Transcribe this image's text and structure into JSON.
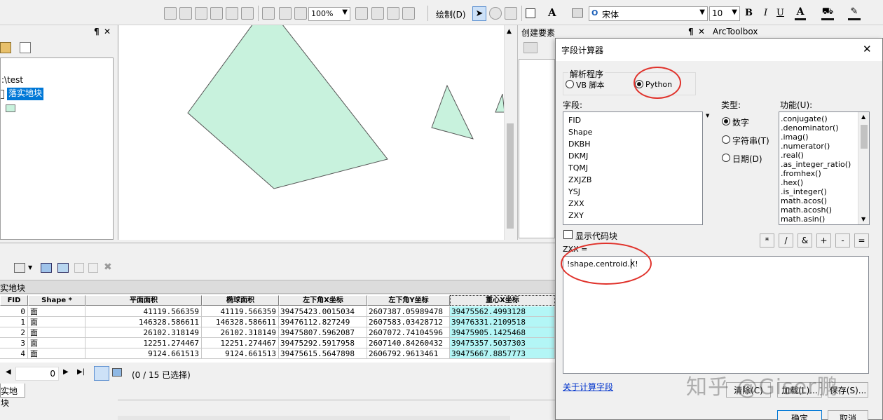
{
  "toolbar": {
    "zoom_value": "100%",
    "draw_label": "绘制(D)",
    "text_tool": "A",
    "font_name": "宋体",
    "font_size": "10",
    "bold": "B",
    "italic": "I",
    "underline": "U"
  },
  "toc": {
    "path": ":\\test",
    "layer": "落实地块"
  },
  "panels": {
    "create_features": "创建要素",
    "arctoolbox": "ArcToolbox",
    "pin": "¶",
    "close": "✕"
  },
  "table": {
    "title": "实地块",
    "columns": [
      "FID",
      "Shape *",
      "平面面积",
      "椭球面积",
      "左下角X坐标",
      "左下角Y坐标",
      "重心X坐标"
    ],
    "rows": [
      [
        "0",
        "面",
        "41119.566359",
        "41119.566359",
        "39475423.0015034",
        "2607387.05989478",
        "39475562.4993128"
      ],
      [
        "1",
        "面",
        "146328.586611",
        "146328.586611",
        "39476112.827249",
        "2607583.03428712",
        "39476331.2109518"
      ],
      [
        "2",
        "面",
        "26102.318149",
        "26102.318149",
        "39475807.5962087",
        "2607072.74104596",
        "39475905.1425468"
      ],
      [
        "3",
        "面",
        "12251.274467",
        "12251.274467",
        "39475292.5917958",
        "2607140.84260432",
        "39475357.5037303"
      ],
      [
        "4",
        "面",
        "9124.661513",
        "9124.661513",
        "39475615.5647898",
        "2606792.9613461",
        "39475667.8857773"
      ]
    ],
    "record_index": "0",
    "selection_status": "(0 / 15 已选择)",
    "tab_label": "实地块"
  },
  "dialog": {
    "title": "字段计算器",
    "parser_label": "解析程序",
    "parser_vb": "VB 脚本",
    "parser_python": "Python",
    "fields_label": "字段:",
    "fields": [
      "FID",
      "Shape",
      "DKBH",
      "DKMJ",
      "TQMJ",
      "ZXJZB",
      "YSJ",
      "ZXX",
      "ZXY"
    ],
    "type_label": "类型:",
    "type_number": "数字",
    "type_string": "字符串(T)",
    "type_date": "日期(D)",
    "functions_label": "功能(U):",
    "functions": [
      ".conjugate()",
      ".denominator()",
      ".imag()",
      ".numerator()",
      ".real()",
      ".as_integer_ratio()",
      ".fromhex()",
      ".hex()",
      ".is_integer()",
      "math.acos()",
      "math.acosh()",
      "math.asin()"
    ],
    "show_codeblock": "显示代码块",
    "operators": [
      "*",
      "/",
      "&",
      "+",
      "-",
      "="
    ],
    "expression_label": "ZXX =",
    "expression": "!shape.centroid.X!",
    "about_link": "关于计算字段",
    "clear_button": "清除(C)",
    "load_button": "加载(L)...",
    "save_button": "保存(S)...",
    "ok_button": "确定",
    "cancel_button": "取消",
    "close": "✕"
  },
  "watermark": "知乎 @Giser鹏",
  "colors": {
    "polygon_fill": "#c8f2dd",
    "selected_cell": "#b3f6f6",
    "highlight": "#0078d7",
    "annotation": "#e0322b",
    "link": "#0033cc"
  }
}
